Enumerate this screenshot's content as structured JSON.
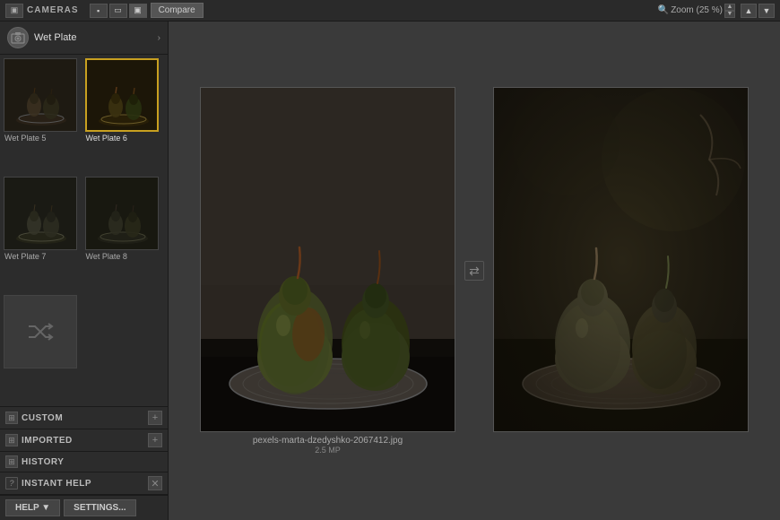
{
  "topbar": {
    "cameras_label": "CAMERAS",
    "view_icons": [
      "▪",
      "▭",
      "▣"
    ],
    "compare_btn": "Compare",
    "zoom_label": "Zoom (25 %)",
    "zoom_up": "▲",
    "zoom_down": "▼",
    "nav_up": "▲",
    "nav_down": "▼"
  },
  "sidebar": {
    "camera_icon": "📷",
    "camera_name": "Wet Plate",
    "camera_arrow": "›",
    "presets": [
      {
        "id": "preset-5",
        "label": "Wet Plate 5",
        "type": "thumb",
        "selected": false
      },
      {
        "id": "preset-6",
        "label": "Wet Plate 6",
        "type": "thumb",
        "selected": true
      },
      {
        "id": "preset-7",
        "label": "Wet Plate 7",
        "type": "thumb",
        "selected": false
      },
      {
        "id": "preset-8",
        "label": "Wet Plate 8",
        "type": "thumb",
        "selected": false
      },
      {
        "id": "preset-shuffle",
        "label": "",
        "type": "shuffle",
        "selected": false
      }
    ],
    "accordion_custom": {
      "icon": "⊞",
      "label": "CUSTOM",
      "plus": "+",
      "question": "?"
    },
    "accordion_imported": {
      "icon": "⊞",
      "label": "IMPORTED",
      "plus": "+",
      "question": "?"
    },
    "accordion_history": {
      "icon": "⊞",
      "label": "HISTORY",
      "question": "?"
    },
    "accordion_instant_help": {
      "icon": "?",
      "label": "INSTANT HELP",
      "close": "✕",
      "question": "?"
    }
  },
  "preview": {
    "left_image_filename": "pexels-marta-dzedyshko-2067412.jpg",
    "left_image_size": "2.5 MP",
    "swap_icon": "⇄"
  },
  "bottombar": {
    "help_btn": "HELP ▼",
    "settings_btn": "SETTINGS..."
  }
}
